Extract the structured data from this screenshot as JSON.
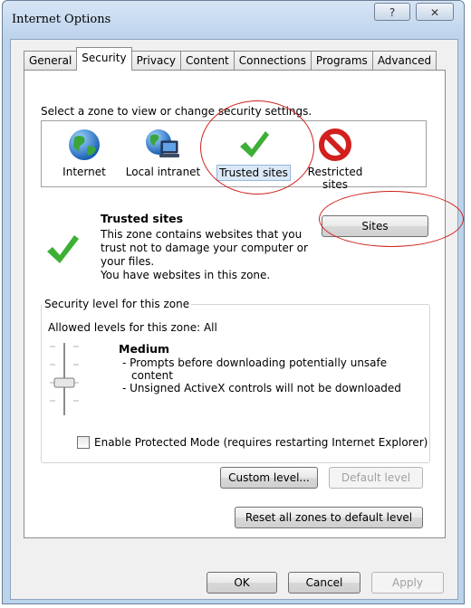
{
  "window": {
    "title": "Internet Options",
    "help_glyph": "?",
    "close_glyph": "✕"
  },
  "tabs": [
    "General",
    "Security",
    "Privacy",
    "Content",
    "Connections",
    "Programs",
    "Advanced"
  ],
  "active_tab": "Security",
  "zones": {
    "prompt": "Select a zone to view or change security settings.",
    "items": [
      {
        "label": "Internet",
        "icon": "globe-icon"
      },
      {
        "label": "Local intranet",
        "icon": "intranet-icon"
      },
      {
        "label": "Trusted sites",
        "icon": "checkmark-icon"
      },
      {
        "label": "Restricted sites",
        "icon": "no-entry-icon"
      }
    ],
    "selected": "Trusted sites"
  },
  "detail": {
    "title": "Trusted sites",
    "desc_lines": [
      "This zone contains websites that you",
      "trust not to damage your computer or",
      "your files.",
      "You have websites in this zone."
    ],
    "sites_button": "Sites"
  },
  "security_level": {
    "legend": "Security level for this zone",
    "allowed": "Allowed levels for this zone: All",
    "level_name": "Medium",
    "level_lines": [
      "- Prompts before downloading potentially unsafe",
      "  content",
      "- Unsigned ActiveX controls will not be downloaded"
    ],
    "slider_level_of_4": 2
  },
  "protected_mode": {
    "label": "Enable Protected Mode (requires restarting Internet Explorer)",
    "checked": false
  },
  "buttons": {
    "custom_level": "Custom level...",
    "default_level": "Default level",
    "reset_all": "Reset all zones to default level",
    "ok": "OK",
    "cancel": "Cancel",
    "apply": "Apply"
  },
  "colors": {
    "highlight_ring": "#d0201a",
    "check_green": "#3cb034",
    "restricted_red": "#d21f1f"
  }
}
